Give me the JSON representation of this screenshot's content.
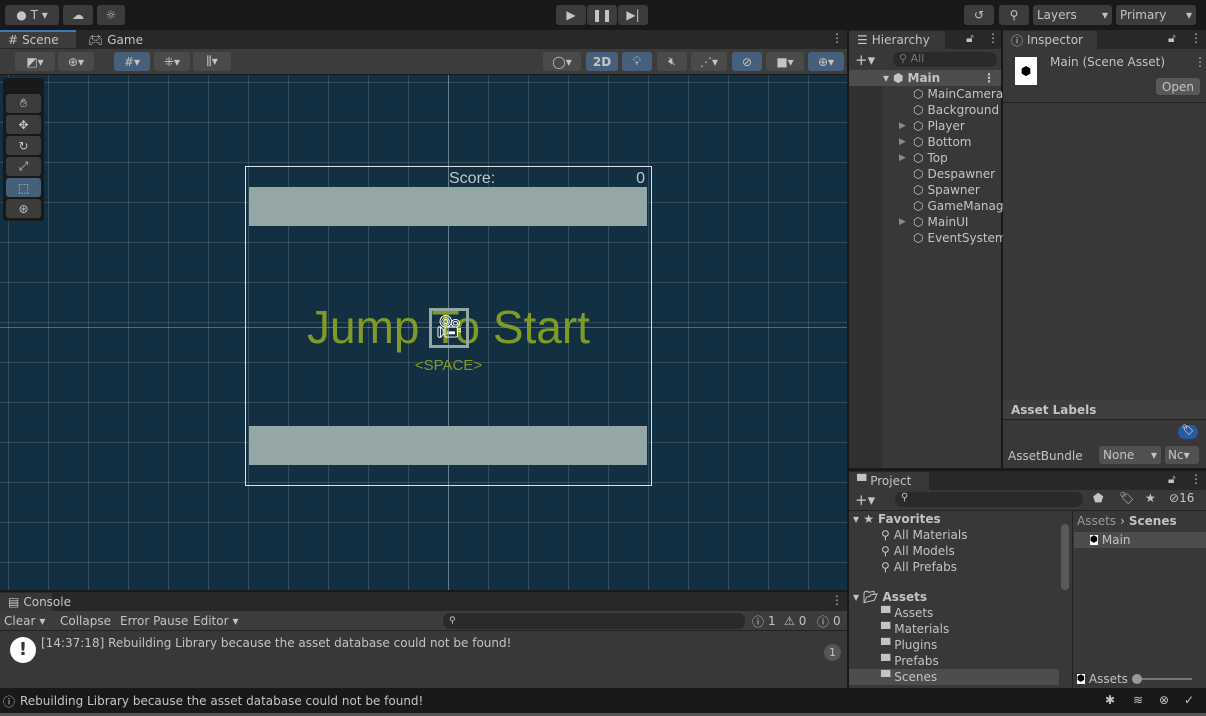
{
  "toolbar": {
    "account": "T",
    "layers": "Layers",
    "layout": "Primary"
  },
  "scene_tabs": {
    "scene": "Scene",
    "game": "Game",
    "mode_2d": "2D"
  },
  "scene": {
    "score_label": "Score:",
    "score_value": "0",
    "title": "Jump To Start",
    "subtitle": "<SPACE>",
    "background": "#133042",
    "text_color": "#7f9a27"
  },
  "hierarchy": {
    "title": "Hierarchy",
    "search_placeholder": "All",
    "root": "Main",
    "items": [
      {
        "label": "MainCamera",
        "expandable": false
      },
      {
        "label": "Background",
        "expandable": false
      },
      {
        "label": "Player",
        "expandable": true
      },
      {
        "label": "Bottom",
        "expandable": true
      },
      {
        "label": "Top",
        "expandable": true
      },
      {
        "label": "Despawner",
        "expandable": false
      },
      {
        "label": "Spawner",
        "expandable": false
      },
      {
        "label": "GameManager",
        "expandable": false
      },
      {
        "label": "MainUI",
        "expandable": true
      },
      {
        "label": "EventSystem",
        "expandable": false
      }
    ]
  },
  "inspector": {
    "title": "Inspector",
    "asset_name": "Main (Scene Asset)",
    "open": "Open",
    "asset_labels": "Asset Labels",
    "asset_bundle": "AssetBundle",
    "bundle_value": "None",
    "variant_value": "None"
  },
  "project": {
    "title": "Project",
    "hidden_count": "16",
    "favorites": "Favorites",
    "favorite_items": [
      "All Materials",
      "All Models",
      "All Prefabs"
    ],
    "assets": "Assets",
    "folders": [
      "Assets",
      "Materials",
      "Plugins",
      "Prefabs",
      "Scenes"
    ],
    "breadcrumb": [
      "Assets",
      "Scenes"
    ],
    "files": [
      "Main"
    ],
    "footer": "Assets"
  },
  "console": {
    "title": "Console",
    "clear": "Clear",
    "collapse": "Collapse",
    "error_pause": "Error Pause",
    "editor": "Editor",
    "log_count": "1",
    "warn_count": "0",
    "error_count": "0",
    "message": "[14:37:18] Rebuilding Library because the asset database could not be found!",
    "message_count": "1"
  },
  "status": {
    "message": "Rebuilding Library because the asset database could not be found!"
  }
}
